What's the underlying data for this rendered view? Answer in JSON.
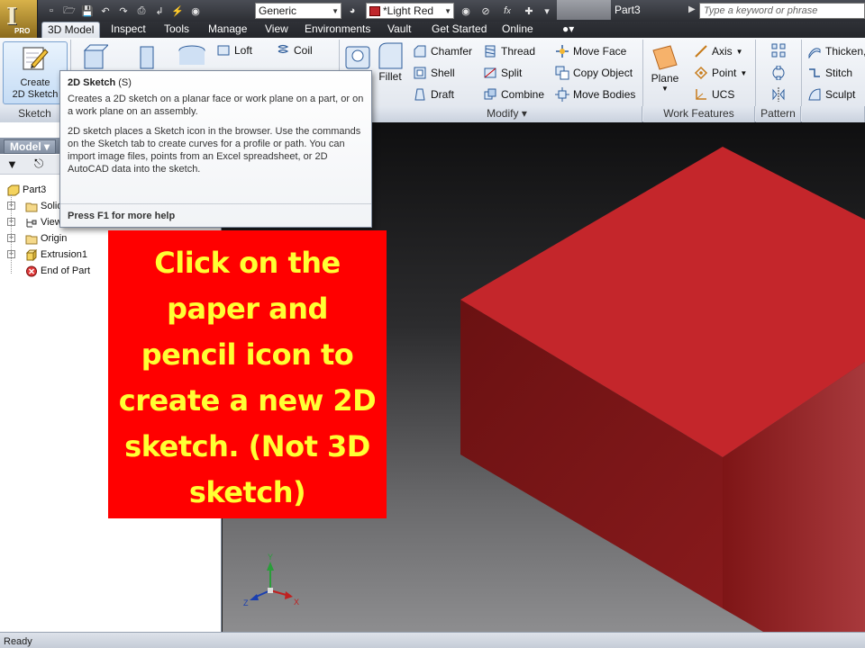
{
  "qat": {
    "material": "Generic",
    "appearance": "*Light Red",
    "document_title": "Part3",
    "search_placeholder": "Type a keyword or phrase",
    "app_badge": "PRO"
  },
  "tabs": [
    "3D Model",
    "Inspect",
    "Tools",
    "Manage",
    "View",
    "Environments",
    "Vault",
    "Get Started",
    "Online"
  ],
  "ribbon": {
    "sketch_panel": {
      "create_line1": "Create",
      "create_line2": "2D Sketch",
      "label": "Sketch"
    },
    "create_buttons": {
      "loft": "Loft",
      "coil": "Coil"
    },
    "fillet": "Fillet",
    "modify": {
      "label": "Modify",
      "chamfer": "Chamfer",
      "thread": "Thread",
      "move_face": "Move Face",
      "shell": "Shell",
      "split": "Split",
      "copy_object": "Copy Object",
      "draft": "Draft",
      "combine": "Combine",
      "move_bodies": "Move Bodies"
    },
    "work_features": {
      "label": "Work Features",
      "plane": "Plane",
      "axis": "Axis",
      "point": "Point",
      "ucs": "UCS"
    },
    "pattern": {
      "label": "Pattern"
    },
    "surface": {
      "thicken": "Thicken,",
      "stitch": "Stitch",
      "sculpt": "Sculpt"
    }
  },
  "browser": {
    "tab": "Model",
    "items": [
      {
        "label": "Part3"
      },
      {
        "label": "Solid"
      },
      {
        "label": "View"
      },
      {
        "label": "Origin"
      },
      {
        "label": "Extrusion1"
      },
      {
        "label": "End of Part"
      }
    ]
  },
  "tooltip": {
    "title": "2D Sketch",
    "shortcut": "(S)",
    "para1": "Creates a 2D sketch on a planar face or work plane on a part, or on a work plane on an assembly.",
    "para2": "2D sketch places a Sketch icon in the browser. Use the commands on the Sketch tab to create curves for a profile or path. You can import image files, points from an Excel spreadsheet, or 2D AutoCAD data into the sketch.",
    "footer": "Press F1 for more help"
  },
  "callout": {
    "lines": [
      "Click on the",
      "paper and",
      "pencil icon to",
      "create a new 2D",
      "sketch.  (Not 3D",
      "sketch)"
    ]
  },
  "viewcube_axes": {
    "x": "X",
    "y": "Y",
    "z": "Z"
  },
  "status": {
    "text": "Ready"
  },
  "colors": {
    "box_top": "#c4262b",
    "box_front": "#7a1416",
    "box_right": "#951c1f",
    "callout_bg": "#ff0000",
    "callout_text": "#ffff33"
  }
}
